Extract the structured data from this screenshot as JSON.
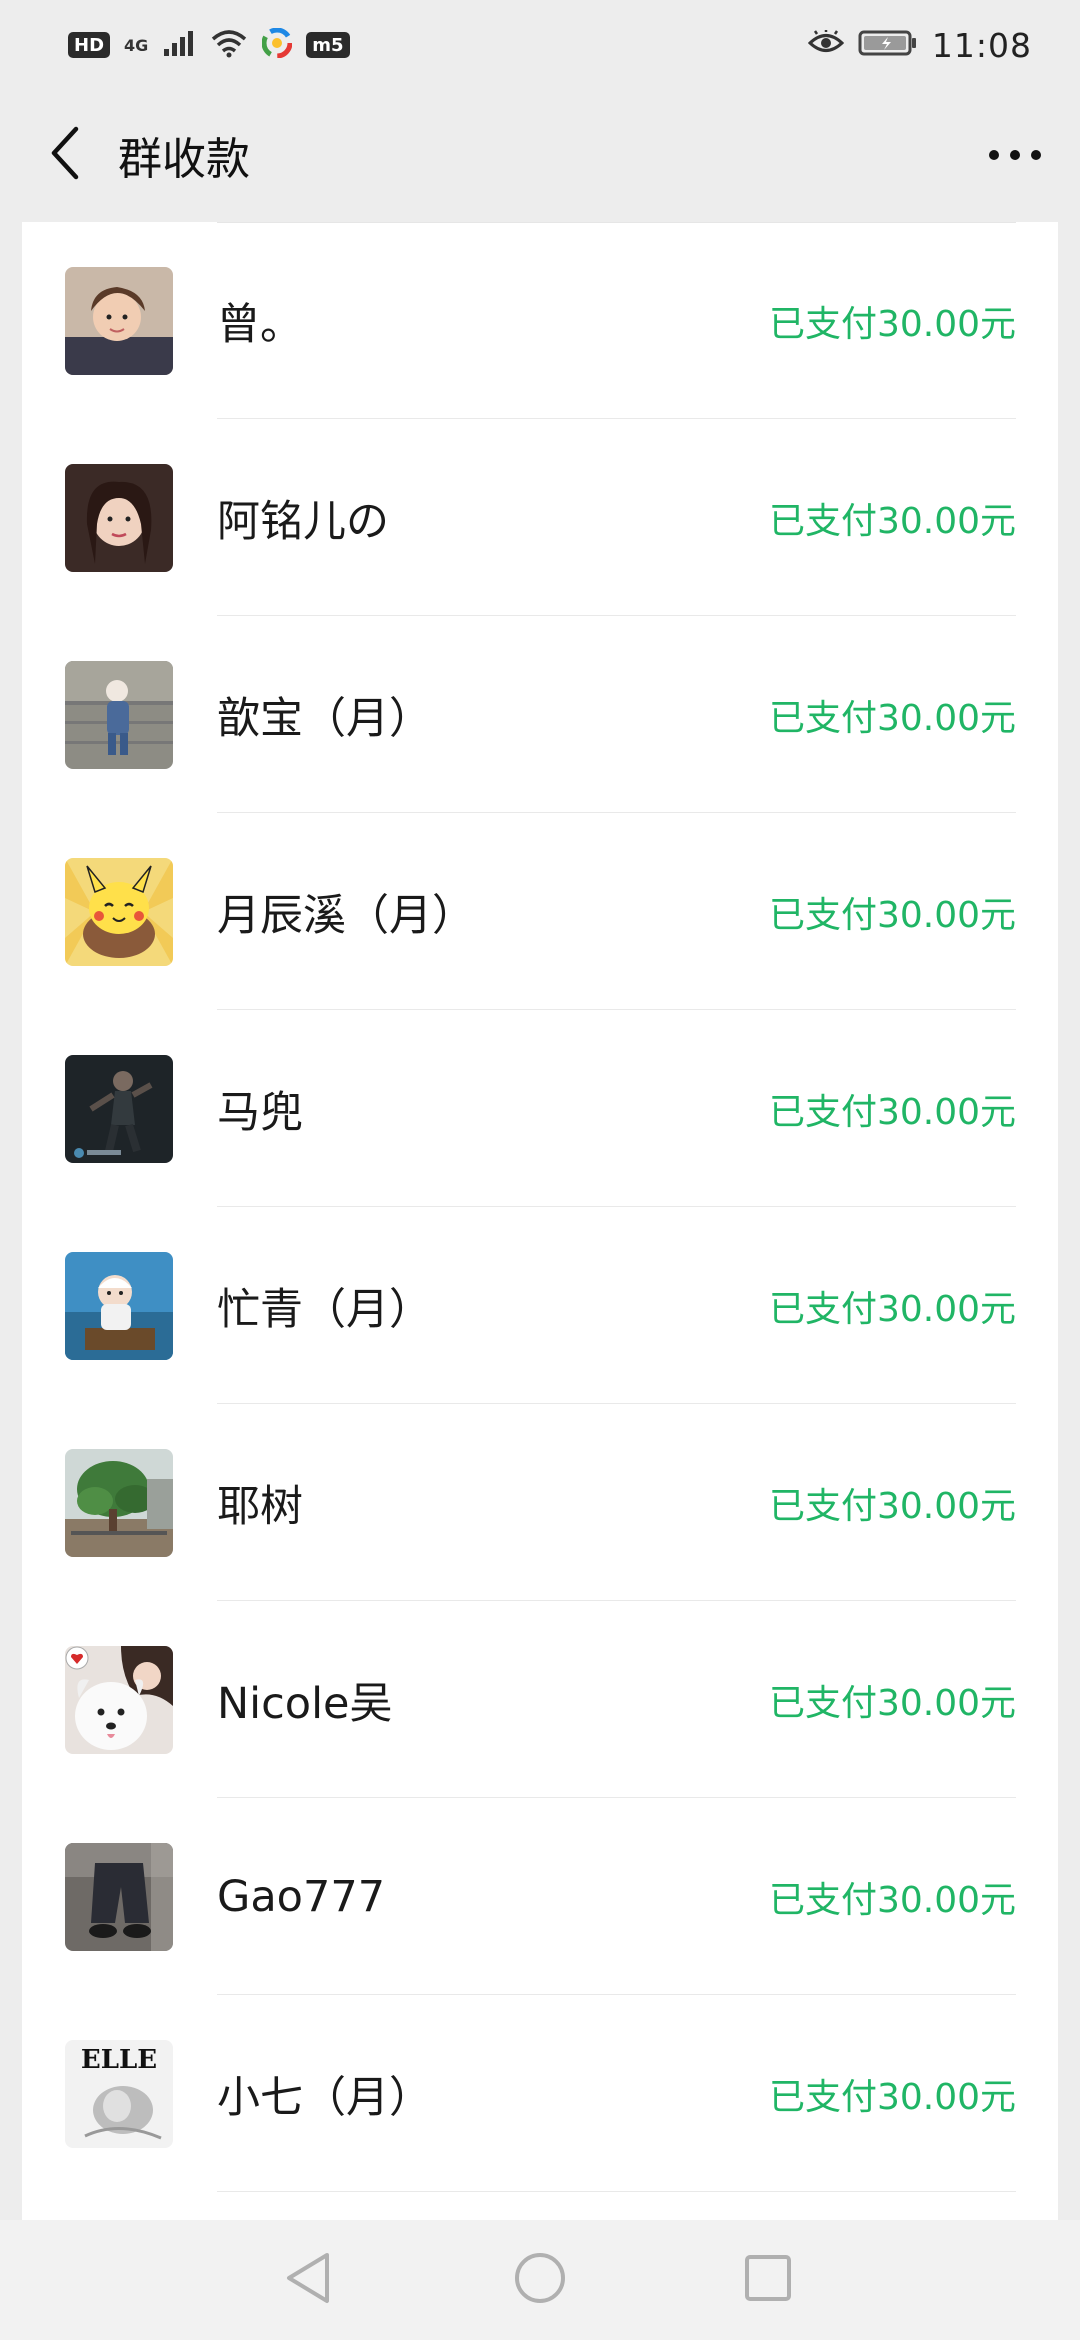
{
  "status_bar": {
    "hd_badge": "HD",
    "network_label": "4G",
    "app_badge": "m5",
    "time": "11:08",
    "icons": [
      "hd-icon",
      "signal-icon",
      "wifi-icon",
      "colorful-app-icon",
      "m5-app-icon",
      "eye-icon",
      "battery-icon"
    ]
  },
  "header": {
    "title": "群收款",
    "back_icon": "back-chevron-icon",
    "more_icon": "more-dots-icon"
  },
  "members": [
    {
      "name": "曾。",
      "status": "已支付30.00元",
      "avatar": "child-photo"
    },
    {
      "name": "阿铭儿の",
      "status": "已支付30.00元",
      "avatar": "woman-portrait"
    },
    {
      "name": "歆宝（月）",
      "status": "已支付30.00元",
      "avatar": "toddler-photo"
    },
    {
      "name": "月辰溪（月）",
      "status": "已支付30.00元",
      "avatar": "cartoon-pikachu"
    },
    {
      "name": "马兜",
      "status": "已支付30.00元",
      "avatar": "dark-dance-photo"
    },
    {
      "name": "忙青（月）",
      "status": "已支付30.00元",
      "avatar": "baby-blue-background"
    },
    {
      "name": "耶树",
      "status": "已支付30.00元",
      "avatar": "garden-tree-photo"
    },
    {
      "name": "Nicole吴",
      "status": "已支付30.00元",
      "avatar": "woman-with-dog"
    },
    {
      "name": "Gao777",
      "status": "已支付30.00元",
      "avatar": "jeans-photo"
    },
    {
      "name": "小七（月）",
      "status": "已支付30.00元",
      "avatar": "elle-magazine"
    }
  ],
  "nav_bar": {
    "icons": [
      "nav-back-icon",
      "nav-home-icon",
      "nav-recents-icon"
    ]
  },
  "colors": {
    "paid_green": "#20b565",
    "background": "#ededed",
    "card": "#ffffff"
  }
}
